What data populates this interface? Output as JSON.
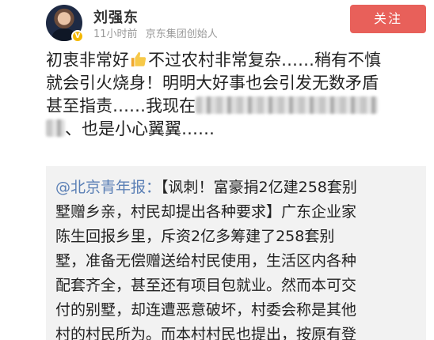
{
  "user": {
    "name": "刘强东",
    "time": "11小时前",
    "source": "京东集团创始人",
    "verified_badge": "V"
  },
  "follow_button": {
    "label": "关注"
  },
  "post": {
    "line1_a": "初衷非常好",
    "line1_b": "不过农村非常复杂……稍有不慎",
    "line2": "就会引火烧身！明明大好事也会引发无数矛盾",
    "line3": "甚至指责……我现在",
    "line4": "、也是小心翼翼……"
  },
  "quote": {
    "mention": "@北京青年报：",
    "line1": "【讽刺！富豪捐2亿建258套别",
    "line2": "墅赠乡亲，村民却提出各种要求】广东企业家",
    "line3": "陈生回报乡里，斥资2亿多筹建了258套别",
    "line4": "墅，准备无偿赠送给村民使用，生活区内各种",
    "line5": "配套齐全，甚至还有项目包就业。然而本可交",
    "line6": "付的别墅，却连遭恶意破坏，村委会称是其他",
    "line7": "村的村民所为。而本村村民也提出，按原有登"
  },
  "colors": {
    "follow_bg": "#e8605a",
    "mention": "#5a7fb5",
    "quote_bg": "#f2f2f2",
    "meta_text": "#999999"
  }
}
